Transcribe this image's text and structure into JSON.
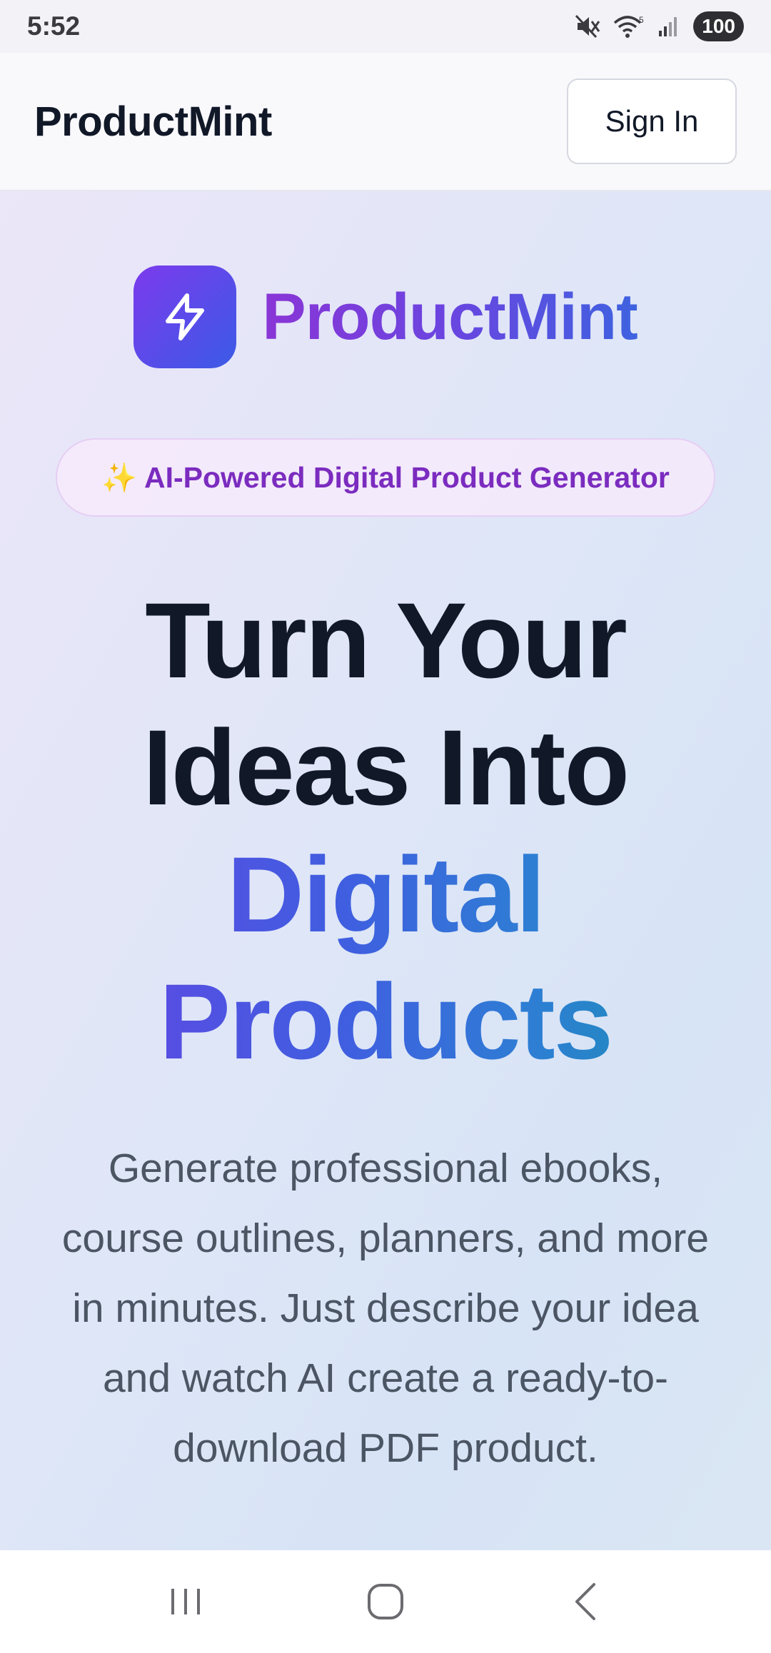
{
  "status_bar": {
    "time": "5:52",
    "battery": "100",
    "icons": [
      "mute-icon",
      "wifi-icon",
      "signal-icon"
    ]
  },
  "header": {
    "brand": "ProductMint",
    "sign_in_label": "Sign In"
  },
  "hero": {
    "logo_icon": "lightning-bolt-icon",
    "logo_text": "ProductMint",
    "badge": {
      "icon": "✨",
      "text": "AI-Powered Digital Product Generator"
    },
    "headline": {
      "line1": "Turn Your",
      "line2": "Ideas Into",
      "line3": "Digital",
      "line4": "Products"
    },
    "description": "Generate professional ebooks, course outlines, planners, and more in minutes. Just describe your idea and watch AI create a ready-to-download PDF product."
  },
  "nav_bar": {
    "buttons": [
      "recent-apps-icon",
      "home-icon",
      "back-icon"
    ]
  },
  "colors": {
    "brand_purple": "#7c3aed",
    "brand_blue": "#3b5be6",
    "heading": "#111827",
    "body_text": "#4b5563"
  }
}
